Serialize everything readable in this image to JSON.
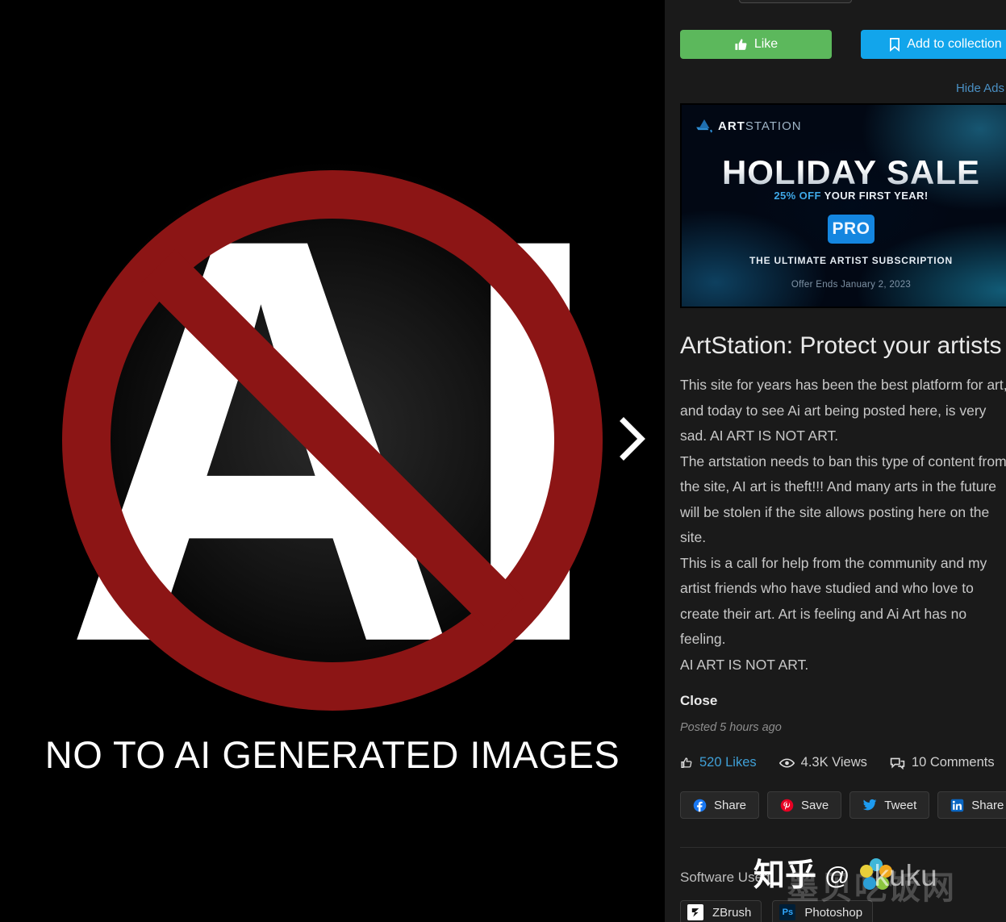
{
  "artwork": {
    "ai_letters": "AI",
    "tagline": "NO TO AI GENERATED IMAGES",
    "next_arrow_icon": "chevron-right-icon",
    "ban_color": "#8c1515",
    "letter_color": "#ffffff",
    "background_color": "#000000"
  },
  "actions": {
    "like_label": "Like",
    "like_icon": "thumbs-up-icon",
    "like_color": "#5cb85c",
    "collection_label": "Add to collection",
    "collection_icon": "bookmark-icon",
    "collection_color": "#12a5eb",
    "hide_ads_label": "Hide Ads",
    "hide_ads_color": "#4a90c4"
  },
  "ad": {
    "brand_bold": "ART",
    "brand_light": "STATION",
    "logo_icon": "artstation-logo-icon",
    "headline": "HOLIDAY SALE",
    "discount": "25% OFF",
    "subline": " YOUR FIRST YEAR!",
    "badge": "PRO",
    "tagline": "THE ULTIMATE ARTIST SUBSCRIPTION",
    "offer_ends": "Offer Ends January 2, 2023",
    "accent_color": "#1486e0"
  },
  "post": {
    "title": "ArtStation: Protect your artists",
    "paragraphs": [
      "This site for years has been the best platform for art, and today to see Ai art being posted here, is very sad. AI ART IS NOT ART.",
      "The artstation needs to ban this type of content from the site, AI art is theft!!! And many arts in the future will be stolen if the site allows posting here on the site.",
      "This is a call for help from the community and my artist friends who have studied and who love to create their art. Art is feeling and Ai Art has no feeling.",
      "AI ART IS NOT ART."
    ],
    "close_label": "Close",
    "posted": "Posted 5 hours ago"
  },
  "stats": [
    {
      "icon": "thumbs-up-icon",
      "label": "520 Likes",
      "name": "likes"
    },
    {
      "icon": "eye-icon",
      "label": "4.3K Views",
      "name": "views"
    },
    {
      "icon": "comments-icon",
      "label": "10 Comments",
      "name": "comments"
    }
  ],
  "share_buttons": [
    {
      "icon": "facebook-icon",
      "label": "Share",
      "color": "#1877f2"
    },
    {
      "icon": "pinterest-icon",
      "label": "Save",
      "color": "#e60023"
    },
    {
      "icon": "twitter-icon",
      "label": "Tweet",
      "color": "#1d9bf0"
    },
    {
      "icon": "linkedin-icon",
      "label": "Share",
      "color": "#0a66c2"
    }
  ],
  "software": {
    "label": "Software Used",
    "items": [
      {
        "icon": "zbrush-icon",
        "label": "ZBrush",
        "short": "Z"
      },
      {
        "icon": "photoshop-icon",
        "label": "Photoshop",
        "short": "Ps"
      }
    ]
  },
  "watermark": {
    "site": "知乎",
    "at": "@",
    "handle": "kuku",
    "overlay_cn": "墨贝吃饭网",
    "logo_icon": "flower-logo-icon"
  }
}
